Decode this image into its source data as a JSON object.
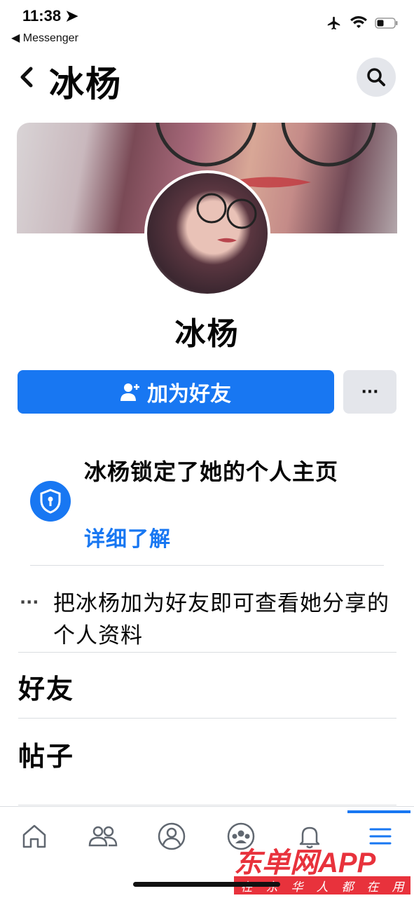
{
  "status_bar": {
    "time": "11:38",
    "back_app": "◀ Messenger"
  },
  "header": {
    "title": "冰杨"
  },
  "profile": {
    "name": "冰杨"
  },
  "actions": {
    "add_friend_label": "加为好友",
    "more_label": "···"
  },
  "lock_notice": {
    "title": "冰杨锁定了她的个人主页",
    "link": "详细了解"
  },
  "info": {
    "dots": "···",
    "text": "把冰杨加为好友即可查看她分享的个人资料"
  },
  "sections": {
    "friends": "好友",
    "posts": "帖子"
  },
  "tabs": [
    {
      "icon": "home-icon"
    },
    {
      "icon": "friends-icon"
    },
    {
      "icon": "profile-icon"
    },
    {
      "icon": "groups-icon"
    },
    {
      "icon": "bell-icon"
    },
    {
      "icon": "menu-icon"
    }
  ],
  "watermark": {
    "title": "东单网APP",
    "subtitle": [
      "在",
      "东",
      "华",
      "人",
      "都",
      "在",
      "用"
    ]
  },
  "colors": {
    "accent": "#1877f2",
    "button_gray": "#e4e6eb",
    "watermark_red": "#e8323c"
  }
}
